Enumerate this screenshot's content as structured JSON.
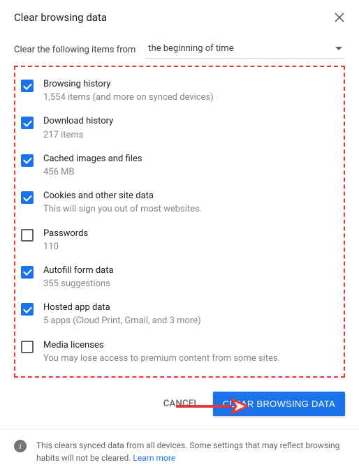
{
  "title": "Clear browsing data",
  "time_prompt": "Clear the following items from",
  "time_value": "the beginning of time",
  "items": [
    {
      "checked": true,
      "label": "Browsing history",
      "sub": "1,554 items (and more on synced devices)"
    },
    {
      "checked": true,
      "label": "Download history",
      "sub": "217 items"
    },
    {
      "checked": true,
      "label": "Cached images and files",
      "sub": "456 MB"
    },
    {
      "checked": true,
      "label": "Cookies and other site data",
      "sub": "This will sign you out of most websites."
    },
    {
      "checked": false,
      "label": "Passwords",
      "sub": "110"
    },
    {
      "checked": true,
      "label": "Autofill form data",
      "sub": "355 suggestions"
    },
    {
      "checked": true,
      "label": "Hosted app data",
      "sub": "5 apps (Cloud Print, Gmail, and 3 more)"
    },
    {
      "checked": false,
      "label": "Media licenses",
      "sub": "You may lose access to premium content from some sites."
    }
  ],
  "actions": {
    "cancel": "Cancel",
    "clear": "Clear browsing data"
  },
  "footer": {
    "text": "This clears synced data from all devices. Some settings that may reflect browsing habits will not be cleared.",
    "learn_more": "Learn more"
  }
}
